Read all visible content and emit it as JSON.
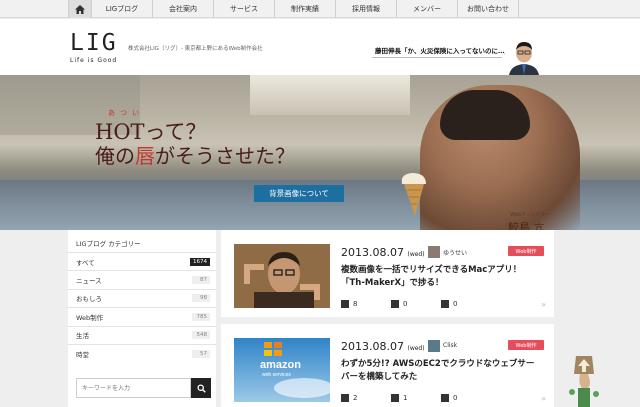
{
  "nav": {
    "items": [
      "LIGブログ",
      "会社案内",
      "サービス",
      "制作実績",
      "採用情報",
      "メンバー",
      "お問い合わせ"
    ]
  },
  "header": {
    "logo": "LIG",
    "logo_sub": "Life is Good",
    "tagline": "株式会社LIG（リグ）- 東京都上野にあるWeb制作会社",
    "speech": "藤田伸長「か、火災保険に入ってないのに…」"
  },
  "hero": {
    "ruby": "あつい",
    "line1": "HOTって？",
    "line2_a": "俺の",
    "line2_red": "唇",
    "line2_b": "がそうさせた？",
    "button": "背景画像について",
    "credit_role": "Webディレクター",
    "credit_name": "鮫島 亢"
  },
  "sidebar": {
    "title": "LIGブログ カテゴリー",
    "items": [
      {
        "label": "すべて",
        "count": "1674"
      },
      {
        "label": "ニュース",
        "count": "87"
      },
      {
        "label": "おもしろ",
        "count": "98"
      },
      {
        "label": "Web制作",
        "count": "785"
      },
      {
        "label": "生活",
        "count": "548"
      },
      {
        "label": "時堂",
        "count": "57"
      }
    ],
    "search_placeholder": "キーワードを入力"
  },
  "posts": [
    {
      "date": "2013.08.07",
      "weekday": "(wed)",
      "author": "ゆうせい",
      "badge": "Web制作",
      "title": "複数画像を一括でリサイズできるMacアプリ！「Th-MakerX」で捗る！",
      "stats": [
        "8",
        "0",
        "0"
      ]
    },
    {
      "date": "2013.08.07",
      "weekday": "(wed)",
      "author": "Clisk",
      "badge": "Web制作",
      "title": "わずか5分!? AWSのEC2でクラウドなウェブサーバーを構築してみた",
      "stats": [
        "2",
        "1",
        "0"
      ],
      "thumb_text": "amazon",
      "thumb_sub": "web services"
    }
  ],
  "colors": {
    "accent_blue": "#1d6fa0",
    "badge_red": "#e74c5a",
    "hero_red": "#c0392b"
  }
}
